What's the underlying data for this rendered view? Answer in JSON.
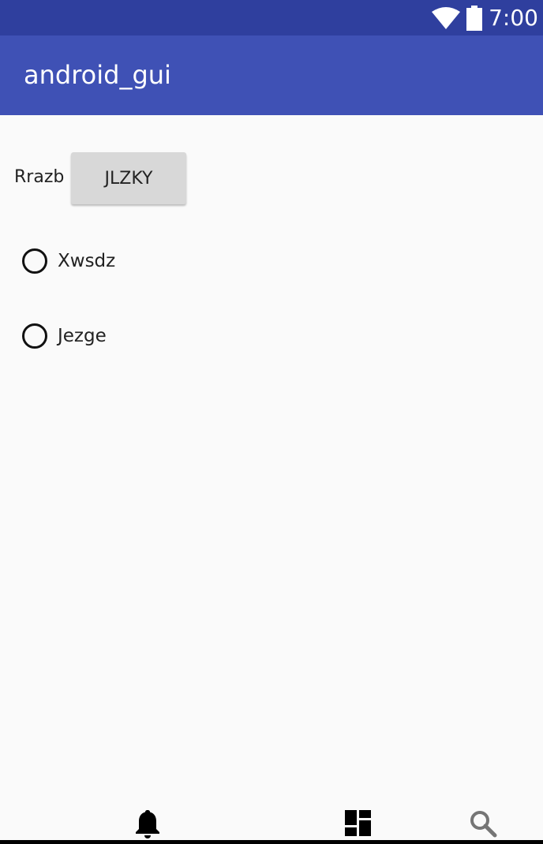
{
  "status_bar": {
    "time": "7:00",
    "icons": [
      "wifi-icon",
      "battery-icon"
    ],
    "background": "#2f3f9e"
  },
  "app_bar": {
    "title": "android_gui",
    "background": "#3f51b5"
  },
  "form": {
    "label": "Rrazb",
    "button_label": "JLZKY"
  },
  "radio_options": [
    {
      "label": "Xwsdz",
      "checked": false
    },
    {
      "label": "Jezge",
      "checked": false
    }
  ],
  "bottom_nav": {
    "icons": [
      "bell-icon",
      "dashboard-icon",
      "search-icon"
    ]
  }
}
